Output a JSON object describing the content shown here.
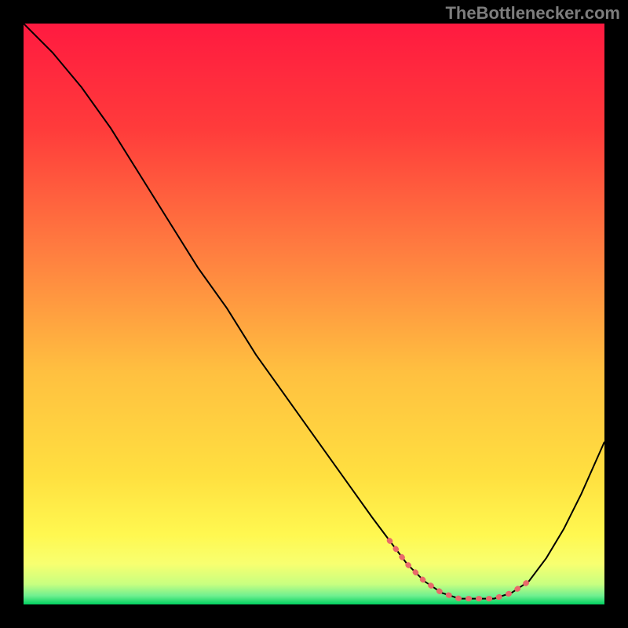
{
  "attribution": "TheBottlenecker.com",
  "chart_data": {
    "type": "line",
    "title": "",
    "xlabel": "",
    "ylabel": "",
    "xlim": [
      0,
      100
    ],
    "ylim": [
      0,
      100
    ],
    "grid": false,
    "series": [
      {
        "name": "curve",
        "color": "#000000",
        "width": 2,
        "x": [
          0,
          5,
          10,
          15,
          20,
          25,
          30,
          35,
          40,
          45,
          50,
          55,
          60,
          63,
          66,
          69,
          72,
          75,
          78,
          81,
          84,
          87,
          90,
          93,
          96,
          100
        ],
        "values": [
          100,
          95,
          89,
          82,
          74,
          66,
          58,
          51,
          43,
          36,
          29,
          22,
          15,
          11,
          7,
          4,
          2,
          1,
          1,
          1,
          2,
          4,
          8,
          13,
          19,
          28
        ]
      },
      {
        "name": "optimal-range",
        "color": "#e86a6a",
        "width": 7,
        "x": [
          63,
          66,
          69,
          72,
          75,
          78,
          81,
          84,
          87
        ],
        "values": [
          11,
          7,
          4,
          2,
          1,
          1,
          1,
          2,
          4
        ]
      }
    ],
    "gradient_stops": [
      {
        "offset": 0.0,
        "color": "#ff1a40"
      },
      {
        "offset": 0.18,
        "color": "#ff3b3b"
      },
      {
        "offset": 0.4,
        "color": "#ff8040"
      },
      {
        "offset": 0.6,
        "color": "#ffc040"
      },
      {
        "offset": 0.78,
        "color": "#ffe040"
      },
      {
        "offset": 0.88,
        "color": "#fff850"
      },
      {
        "offset": 0.93,
        "color": "#f8ff70"
      },
      {
        "offset": 0.965,
        "color": "#c8ff80"
      },
      {
        "offset": 0.985,
        "color": "#70f090"
      },
      {
        "offset": 1.0,
        "color": "#00d060"
      }
    ]
  }
}
